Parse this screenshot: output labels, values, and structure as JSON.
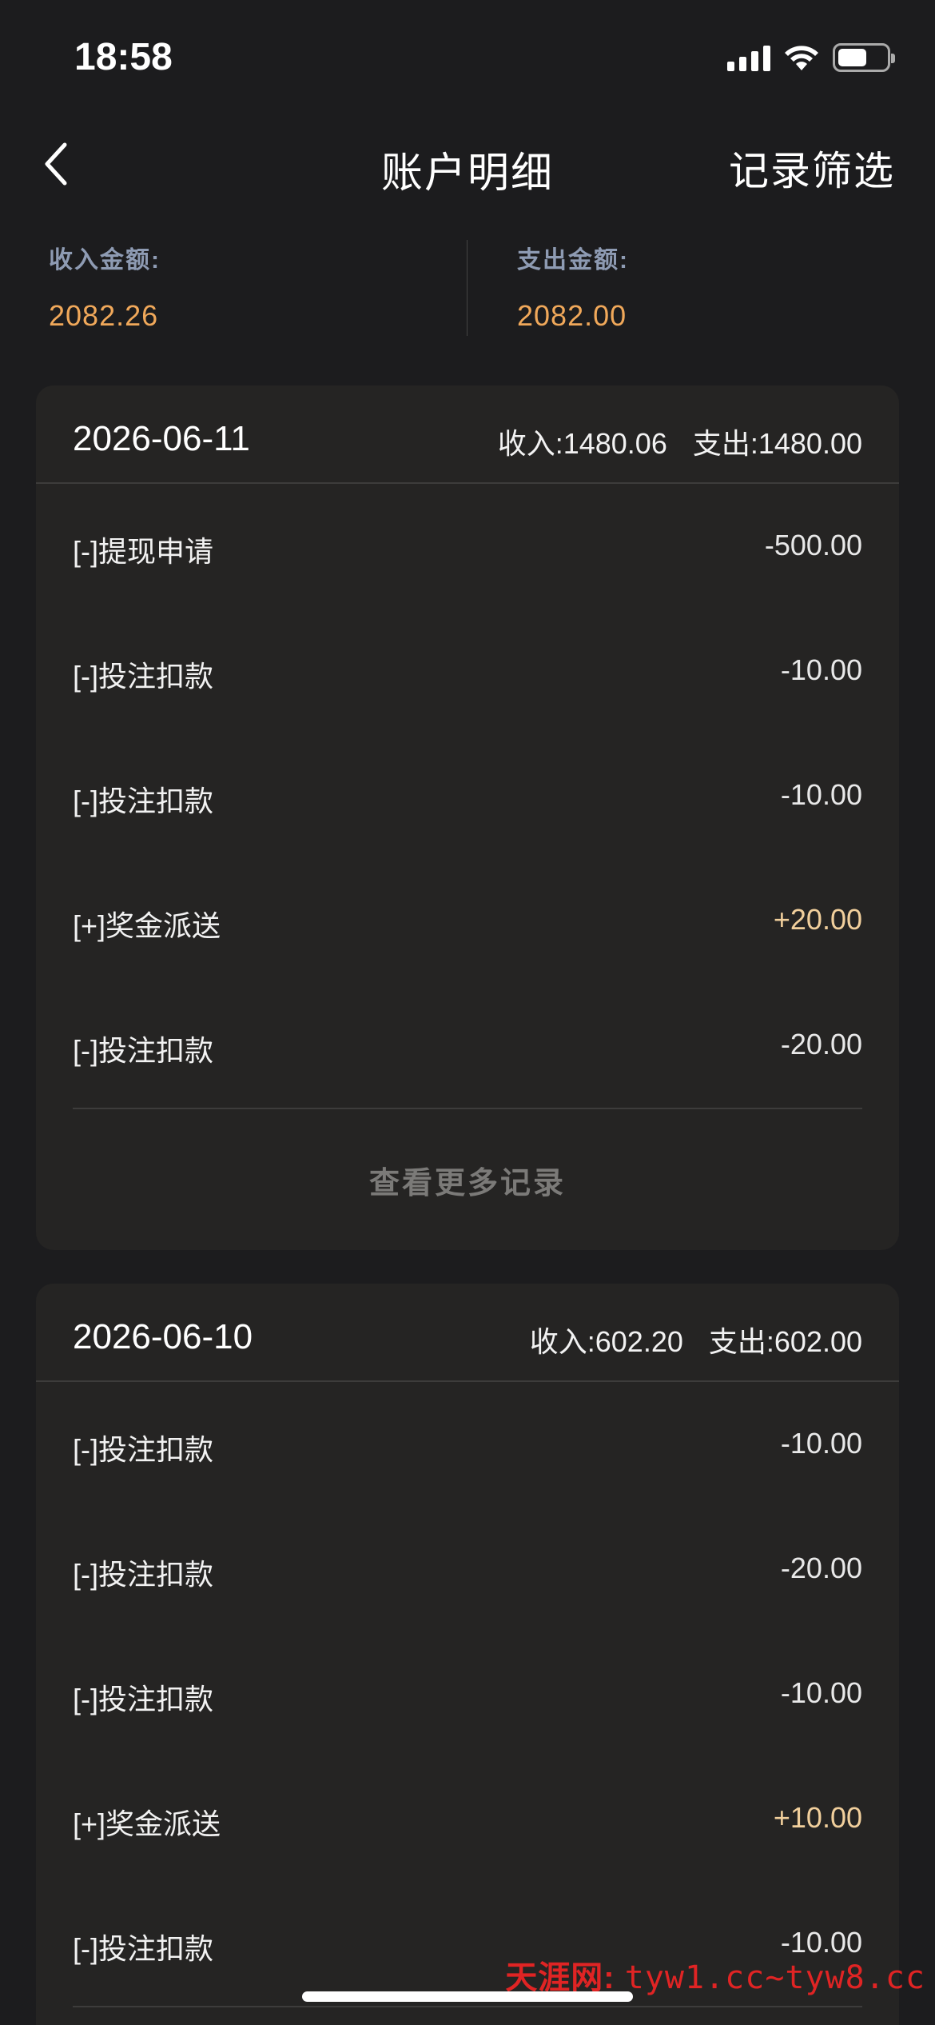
{
  "status_bar": {
    "time": "18:58",
    "battery_level": 0.6,
    "icons": [
      "cellular-signal-icon",
      "wifi-icon",
      "battery-icon"
    ]
  },
  "nav": {
    "back_icon": "chevron-left-icon",
    "title": "账户明细",
    "filter_label": "记录筛选"
  },
  "summary": {
    "income_label": "收入金额:",
    "income_value": "2082.26",
    "expense_label": "支出金额:",
    "expense_value": "2082.00"
  },
  "groups": [
    {
      "date": "2026-06-11",
      "income": "收入:1480.06",
      "expense": "支出:1480.00",
      "rows": [
        {
          "label": "[-]提现申请",
          "amount": "-500.00",
          "positive": false
        },
        {
          "label": "[-]投注扣款",
          "amount": "-10.00",
          "positive": false
        },
        {
          "label": "[-]投注扣款",
          "amount": "-10.00",
          "positive": false
        },
        {
          "label": "[+]奖金派送",
          "amount": "+20.00",
          "positive": true
        },
        {
          "label": "[-]投注扣款",
          "amount": "-20.00",
          "positive": false
        }
      ],
      "more_label": "查看更多记录"
    },
    {
      "date": "2026-06-10",
      "income": "收入:602.20",
      "expense": "支出:602.00",
      "rows": [
        {
          "label": "[-]投注扣款",
          "amount": "-10.00",
          "positive": false
        },
        {
          "label": "[-]投注扣款",
          "amount": "-20.00",
          "positive": false
        },
        {
          "label": "[-]投注扣款",
          "amount": "-10.00",
          "positive": false
        },
        {
          "label": "[+]奖金派送",
          "amount": "+10.00",
          "positive": true
        },
        {
          "label": "[-]投注扣款",
          "amount": "-10.00",
          "positive": false
        }
      ]
    }
  ],
  "watermark": {
    "site": "天涯网:",
    "urls": "tyw1.cc~tyw8.cc"
  },
  "colors": {
    "background": "#1c1c1e",
    "card": "#252423",
    "accent_orange": "#f0a85a",
    "positive_amount": "#f1cf9c",
    "label_muted": "#8e9bb3"
  }
}
